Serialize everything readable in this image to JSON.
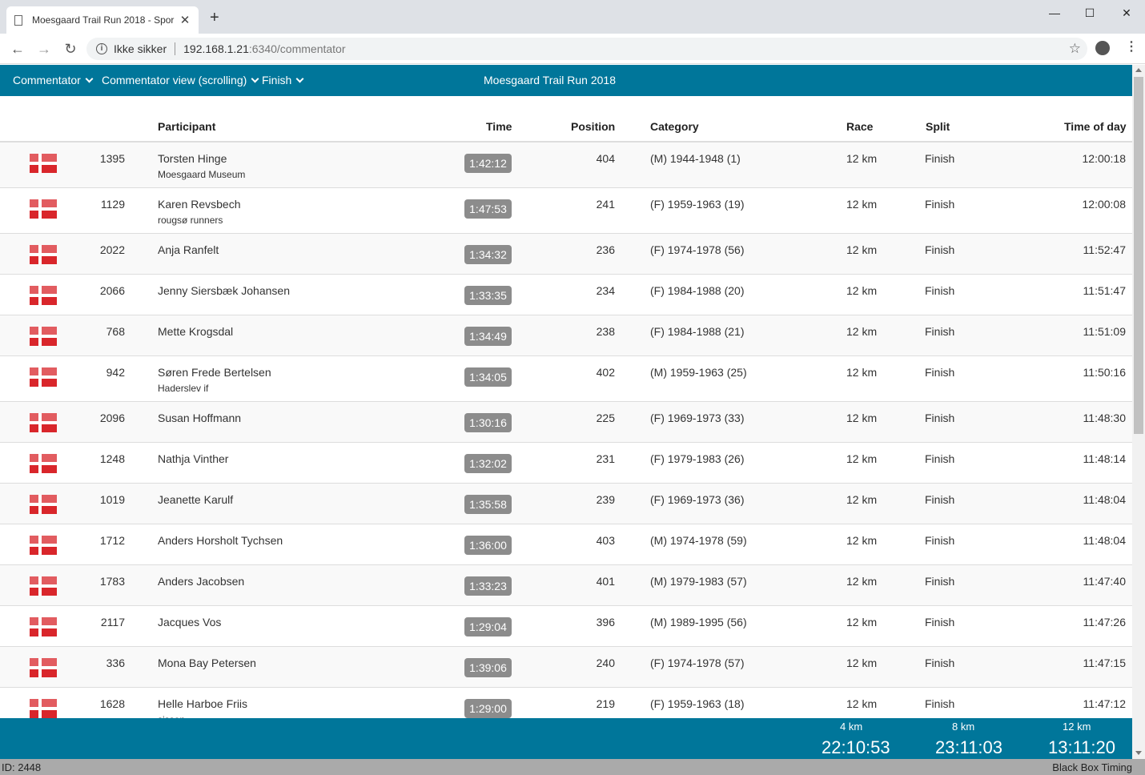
{
  "browser": {
    "tab_title": "Moesgaard Trail Run 2018 - Spor",
    "new_tab": "+",
    "security": "Ikke sikker",
    "url_host": "192.168.1.21",
    "url_rest": ":6340/commentator",
    "minimize": "—",
    "maximize": "☐",
    "close": "✕"
  },
  "appbar": {
    "menu1": "Commentator",
    "menu2": "Commentator view (scrolling)",
    "menu3": "Finish",
    "title": "Moesgaard Trail Run 2018"
  },
  "table": {
    "headers": {
      "participant": "Participant",
      "time": "Time",
      "position": "Position",
      "category": "Category",
      "race": "Race",
      "split": "Split",
      "time_of_day": "Time of day"
    },
    "rows": [
      {
        "bib": "1395",
        "name": "Torsten Hinge",
        "club": "Moesgaard Museum",
        "time": "1:42:12",
        "position": "404",
        "category": "(M) 1944-1948 (1)",
        "race": "12 km",
        "split": "Finish",
        "tod": "12:00:18"
      },
      {
        "bib": "1129",
        "name": "Karen Revsbech",
        "club": "rougsø runners",
        "time": "1:47:53",
        "position": "241",
        "category": "(F) 1959-1963 (19)",
        "race": "12 km",
        "split": "Finish",
        "tod": "12:00:08"
      },
      {
        "bib": "2022",
        "name": "Anja Ranfelt",
        "club": "",
        "time": "1:34:32",
        "position": "236",
        "category": "(F) 1974-1978 (56)",
        "race": "12 km",
        "split": "Finish",
        "tod": "11:52:47"
      },
      {
        "bib": "2066",
        "name": "Jenny Siersbæk Johansen",
        "club": "",
        "time": "1:33:35",
        "position": "234",
        "category": "(F) 1984-1988 (20)",
        "race": "12 km",
        "split": "Finish",
        "tod": "11:51:47"
      },
      {
        "bib": "768",
        "name": "Mette Krogsdal",
        "club": "",
        "time": "1:34:49",
        "position": "238",
        "category": "(F) 1984-1988 (21)",
        "race": "12 km",
        "split": "Finish",
        "tod": "11:51:09"
      },
      {
        "bib": "942",
        "name": "Søren Frede Bertelsen",
        "club": "Haderslev if",
        "time": "1:34:05",
        "position": "402",
        "category": "(M) 1959-1963 (25)",
        "race": "12 km",
        "split": "Finish",
        "tod": "11:50:16"
      },
      {
        "bib": "2096",
        "name": "Susan Hoffmann",
        "club": "",
        "time": "1:30:16",
        "position": "225",
        "category": "(F) 1969-1973 (33)",
        "race": "12 km",
        "split": "Finish",
        "tod": "11:48:30"
      },
      {
        "bib": "1248",
        "name": "Nathja Vinther",
        "club": "",
        "time": "1:32:02",
        "position": "231",
        "category": "(F) 1979-1983 (26)",
        "race": "12 km",
        "split": "Finish",
        "tod": "11:48:14"
      },
      {
        "bib": "1019",
        "name": "Jeanette Karulf",
        "club": "",
        "time": "1:35:58",
        "position": "239",
        "category": "(F) 1969-1973 (36)",
        "race": "12 km",
        "split": "Finish",
        "tod": "11:48:04"
      },
      {
        "bib": "1712",
        "name": "Anders Horsholt Tychsen",
        "club": "",
        "time": "1:36:00",
        "position": "403",
        "category": "(M) 1974-1978 (59)",
        "race": "12 km",
        "split": "Finish",
        "tod": "11:48:04"
      },
      {
        "bib": "1783",
        "name": "Anders Jacobsen",
        "club": "",
        "time": "1:33:23",
        "position": "401",
        "category": "(M) 1979-1983 (57)",
        "race": "12 km",
        "split": "Finish",
        "tod": "11:47:40"
      },
      {
        "bib": "2117",
        "name": "Jacques Vos",
        "club": "",
        "time": "1:29:04",
        "position": "396",
        "category": "(M) 1989-1995 (56)",
        "race": "12 km",
        "split": "Finish",
        "tod": "11:47:26"
      },
      {
        "bib": "336",
        "name": "Mona Bay Petersen",
        "club": "",
        "time": "1:39:06",
        "position": "240",
        "category": "(F) 1974-1978 (57)",
        "race": "12 km",
        "split": "Finish",
        "tod": "11:47:15"
      },
      {
        "bib": "1628",
        "name": "Helle Harboe Friis",
        "club": "sisson",
        "time": "1:29:00",
        "position": "219",
        "category": "(F) 1959-1963 (18)",
        "race": "12 km",
        "split": "Finish",
        "tod": "11:47:12"
      }
    ]
  },
  "footer": {
    "splits": [
      {
        "label": "4 km",
        "time": "22:10:53"
      },
      {
        "label": "8 km",
        "time": "23:11:03"
      },
      {
        "label": "12 km",
        "time": "13:11:20"
      }
    ]
  },
  "status": {
    "left": "ID: 2448",
    "right": "Black Box Timing"
  },
  "colors": {
    "accent": "#00769a",
    "time_badge": "#8c8c8c",
    "flag_red": "#d9262b"
  }
}
